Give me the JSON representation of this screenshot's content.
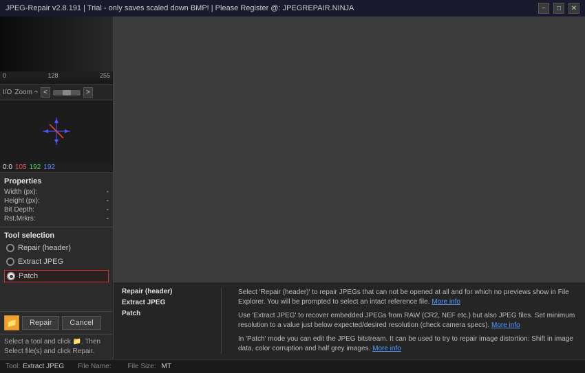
{
  "window": {
    "title": "JPEG-Repair v2.8.191 | Trial - only saves scaled down BMP! | Please Register @: JPEGREPAIR.NINJA",
    "controls": {
      "minimize": "−",
      "maximize": "□",
      "close": "✕"
    }
  },
  "left_panel": {
    "ruler": {
      "left": "0",
      "mid": "128",
      "right": "255"
    },
    "toolbar": {
      "io_label": "I/O",
      "zoom_label": "Zoom ÷",
      "nav_left": "<",
      "nav_right": ">"
    },
    "coords": {
      "pos": "0:0",
      "r": "105",
      "g": "192",
      "b": "192"
    },
    "properties": {
      "title": "Properties",
      "fields": [
        {
          "label": "Width (px):",
          "value": "-"
        },
        {
          "label": "Height (px):",
          "value": "-"
        },
        {
          "label": "Bit Depth:",
          "value": "-"
        },
        {
          "label": "Rst.Mrkrs:",
          "value": "-"
        }
      ]
    },
    "tool_selection": {
      "title": "Tool selection",
      "options": [
        {
          "id": "repair",
          "label": "Repair (header)",
          "selected": false
        },
        {
          "id": "extract",
          "label": "Extract JPEG",
          "selected": false
        },
        {
          "id": "patch",
          "label": "Patch",
          "selected": true
        }
      ]
    },
    "actions": {
      "folder_icon": "📁",
      "repair_btn": "Repair",
      "cancel_btn": "Cancel"
    },
    "instruction": "Select a tool and click 📁. Then\nSelect file(s) and click Repair."
  },
  "info_panel": {
    "repair_header": {
      "title": "Repair (header)",
      "text": "Select 'Repair (header)' to repair JPEGs that can not be opened at all and for which no previews show in File Explorer. You will be prompted to select an intact reference file.",
      "link_text": "More info"
    },
    "extract_jpeg": {
      "title": "Extract JPEG",
      "text": "Use 'Extract JPEG' to recover embedded JPEGs from RAW (CR2, NEF etc.) but also JPEG files. Set minimum resolution to a value just below expected/desired resolution (check camera specs).",
      "link_text": "More info"
    },
    "patch": {
      "title": "Patch",
      "text": "In 'Patch' mode you can edit the JPEG bitstream. It can be used to try to repair image distortion: Shift in image data, color corruption and half grey images.",
      "link_text": "More info"
    }
  },
  "status_bar": {
    "tool_label": "Tool:",
    "tool_value": "Extract JPEG",
    "filename_label": "File Name:",
    "filename_value": "",
    "filesize_label": "File Size:",
    "filesize_value": "",
    "unit": "MT"
  }
}
